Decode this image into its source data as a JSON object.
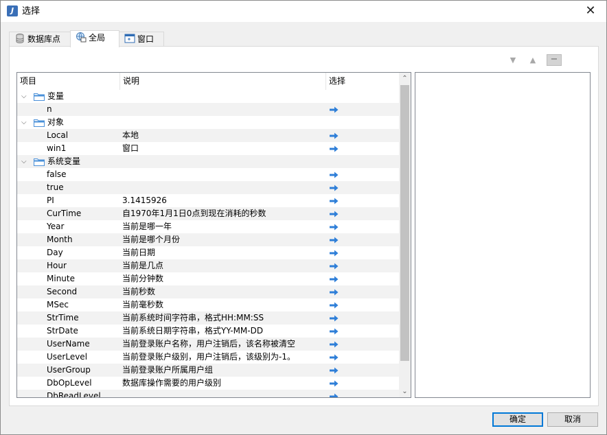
{
  "window": {
    "title": "选择",
    "close_glyph": "✕"
  },
  "tabs": [
    {
      "label": "数据库点",
      "icon": "database-icon"
    },
    {
      "label": "全局",
      "icon": "globe-icon"
    },
    {
      "label": "窗口",
      "icon": "window-icon"
    }
  ],
  "toolbar": {
    "down_glyph": "▼",
    "up_glyph": "▲",
    "minus_glyph": "−"
  },
  "tree": {
    "columns": [
      "项目",
      "说明",
      "选择"
    ],
    "rows": [
      {
        "type": "group",
        "label": "变量"
      },
      {
        "type": "item",
        "name": "n",
        "desc": ""
      },
      {
        "type": "group",
        "label": "对象"
      },
      {
        "type": "item",
        "name": "Local",
        "desc": "本地"
      },
      {
        "type": "item",
        "name": "win1",
        "desc": "窗口"
      },
      {
        "type": "group",
        "label": "系统变量"
      },
      {
        "type": "item",
        "name": "false",
        "desc": ""
      },
      {
        "type": "item",
        "name": "true",
        "desc": ""
      },
      {
        "type": "item",
        "name": "PI",
        "desc": "3.1415926"
      },
      {
        "type": "item",
        "name": "CurTime",
        "desc": "自1970年1月1日0点到现在消耗的秒数"
      },
      {
        "type": "item",
        "name": "Year",
        "desc": "当前是哪一年"
      },
      {
        "type": "item",
        "name": "Month",
        "desc": "当前是哪个月份"
      },
      {
        "type": "item",
        "name": "Day",
        "desc": "当前日期"
      },
      {
        "type": "item",
        "name": "Hour",
        "desc": "当前是几点"
      },
      {
        "type": "item",
        "name": "Minute",
        "desc": "当前分钟数"
      },
      {
        "type": "item",
        "name": "Second",
        "desc": "当前秒数"
      },
      {
        "type": "item",
        "name": "MSec",
        "desc": "当前毫秒数"
      },
      {
        "type": "item",
        "name": "StrTime",
        "desc": "当前系统时间字符串，格式HH:MM:SS"
      },
      {
        "type": "item",
        "name": "StrDate",
        "desc": "当前系统日期字符串，格式YY-MM-DD"
      },
      {
        "type": "item",
        "name": "UserName",
        "desc": "当前登录账户名称，用户注销后，该名称被清空"
      },
      {
        "type": "item",
        "name": "UserLevel",
        "desc": "当前登录账户级别，用户注销后，该级别为-1。"
      },
      {
        "type": "item",
        "name": "UserGroup",
        "desc": "当前登录账户所属用户组"
      },
      {
        "type": "item",
        "name": "DbOpLevel",
        "desc": "数据库操作需要的用户级别"
      },
      {
        "type": "item",
        "name": "DbReadLevel",
        "desc": ""
      }
    ]
  },
  "buttons": {
    "ok": "确定",
    "cancel": "取消"
  },
  "colors": {
    "arrow": "#2f7fd8",
    "folder": "#4a90d9",
    "accent": "#0078d7"
  }
}
